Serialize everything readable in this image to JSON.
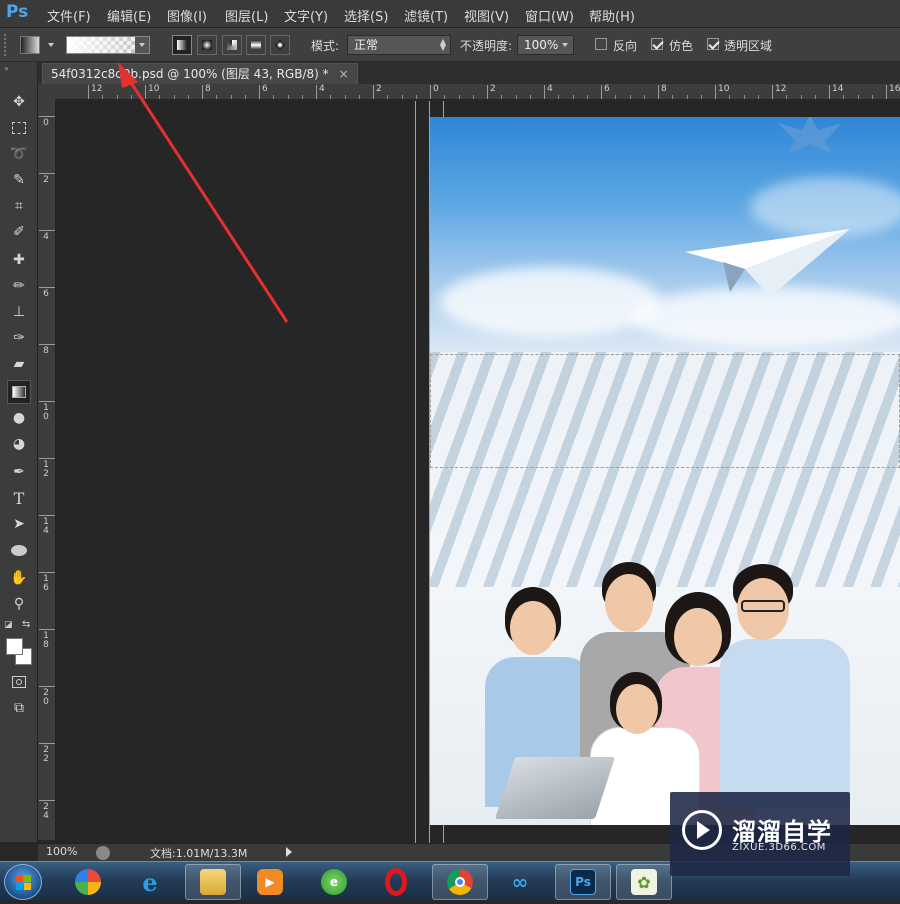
{
  "app": {
    "logo_text": "Ps",
    "accent": "#4ea6ea"
  },
  "menu": {
    "items": [
      "文件(F)",
      "编辑(E)",
      "图像(I)",
      "图层(L)",
      "文字(Y)",
      "选择(S)",
      "滤镜(T)",
      "视图(V)",
      "窗口(W)",
      "帮助(H)"
    ]
  },
  "options": {
    "mode_label": "模式:",
    "mode_value": "正常",
    "opacity_label": "不透明度:",
    "opacity_value": "100%",
    "reverse_label": "反向",
    "reverse_checked": false,
    "dither_label": "仿色",
    "dither_checked": true,
    "transparency_label": "透明区域",
    "transparency_checked": true,
    "gradient_types": [
      "linear-gradient-icon",
      "radial-gradient-icon",
      "angle-gradient-icon",
      "reflected-gradient-icon",
      "diamond-gradient-icon"
    ],
    "active_gradient_type": "linear-gradient-icon"
  },
  "document": {
    "tab_title": "54f0312c8d0b.psd @ 100% (图层 43, RGB/8) *",
    "close_glyph": "×"
  },
  "rulers": {
    "horizontal": [
      "12",
      "10",
      "8",
      "6",
      "4",
      "2",
      "0",
      "2",
      "4",
      "6",
      "8",
      "10",
      "12",
      "14",
      "16"
    ],
    "vertical": [
      "0",
      "2",
      "4",
      "6",
      "8",
      "10",
      "12",
      "14",
      "16",
      "18",
      "20",
      "22",
      "24"
    ]
  },
  "toolbar": {
    "tools": [
      "move-icon",
      "marquee-icon",
      "lasso-icon",
      "quick-select-icon",
      "crop-icon",
      "eyedropper-icon",
      "healing-icon",
      "brush-icon",
      "stamp-icon",
      "history-brush-icon",
      "eraser-icon",
      "gradient-icon",
      "blur-icon",
      "dodge-icon",
      "pen-icon",
      "type-icon",
      "path-select-icon",
      "ellipse-icon",
      "hand-icon",
      "zoom-icon"
    ],
    "active_tool": "gradient-icon",
    "type_tool_glyph": "T"
  },
  "status": {
    "zoom": "100%",
    "doc_info": "文档:1.01M/13.3M"
  },
  "taskbar": {
    "apps": [
      "windows-start-icon",
      "pinyin-icon",
      "internet-explorer-icon",
      "file-explorer-icon",
      "media-player-icon",
      "360-browser-icon",
      "opera-icon",
      "chrome-icon",
      "baidu-cloud-icon",
      "photoshop-icon",
      "image-viewer-icon"
    ],
    "photoshop_label": "Ps"
  },
  "watermark": {
    "title": "溜溜自学",
    "url": "ZIXUE.3D66.COM"
  }
}
